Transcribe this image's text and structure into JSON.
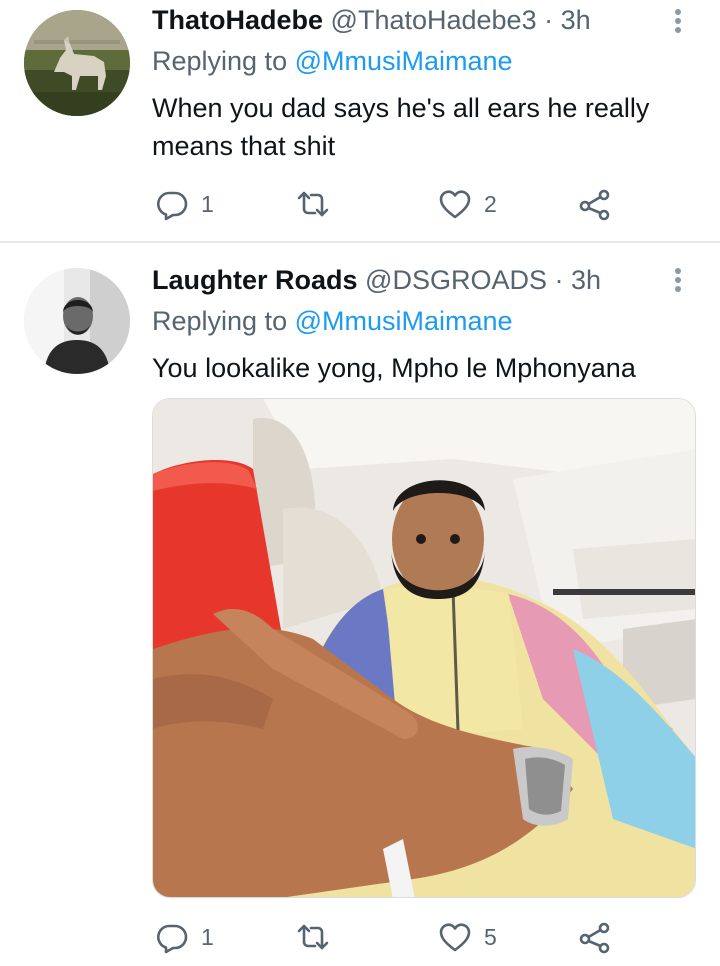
{
  "tweets": [
    {
      "name": "ThatoHadebe",
      "handle": "@ThatoHadebe3",
      "separator": "·",
      "time": "3h",
      "replying_prefix": "Replying to",
      "replying_to": "@MmusiMaimane",
      "text": "When you dad says he's all ears he really means that shit",
      "reply_count": "1",
      "retweet_count": "",
      "like_count": "2"
    },
    {
      "name": "Laughter Roads",
      "handle": "@DSGROADS",
      "separator": "·",
      "time": "3h",
      "replying_prefix": "Replying to",
      "replying_to": "@MmusiMaimane",
      "text": "You lookalike yong, Mpho le Mphonyana",
      "reply_count": "1",
      "retweet_count": "",
      "like_count": "5"
    }
  ],
  "icons": {
    "reply": "reply-icon",
    "retweet": "retweet-icon",
    "like": "heart-icon",
    "share": "share-icon",
    "more": "more-vertical-icon"
  },
  "colors": {
    "text": "#0f1419",
    "secondary": "#566370",
    "link": "#1d9bf0",
    "divider": "#e6e9eb"
  }
}
